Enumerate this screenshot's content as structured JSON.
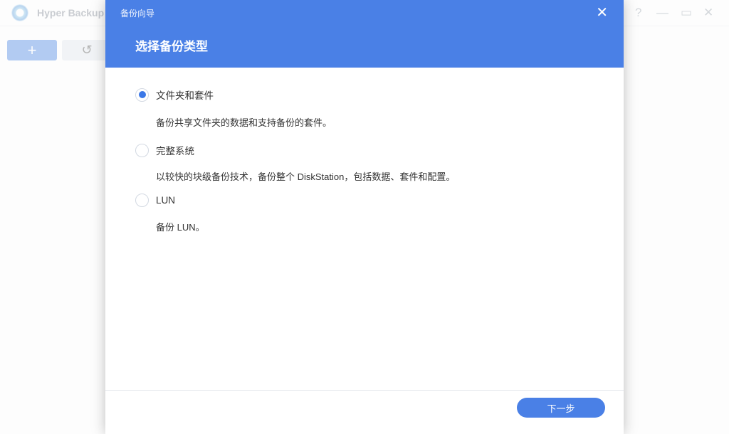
{
  "app": {
    "title": "Hyper Backup",
    "add_label": "+",
    "history_icon": "↺",
    "help": "?",
    "minimize": "—",
    "maximize": "▭",
    "close": "✕"
  },
  "dialog": {
    "title": "备份向导",
    "heading": "选择备份类型",
    "close": "✕",
    "options": [
      {
        "label": "文件夹和套件",
        "desc": "备份共享文件夹的数据和支持备份的套件。",
        "selected": true
      },
      {
        "label": "完整系统",
        "desc": "以较快的块级备份技术，备份整个 DiskStation，包括数据、套件和配置。",
        "selected": false
      },
      {
        "label": "LUN",
        "desc": "备份 LUN。",
        "selected": false
      }
    ],
    "next_label": "下一步"
  },
  "colors": {
    "accent": "#4a80e6"
  }
}
